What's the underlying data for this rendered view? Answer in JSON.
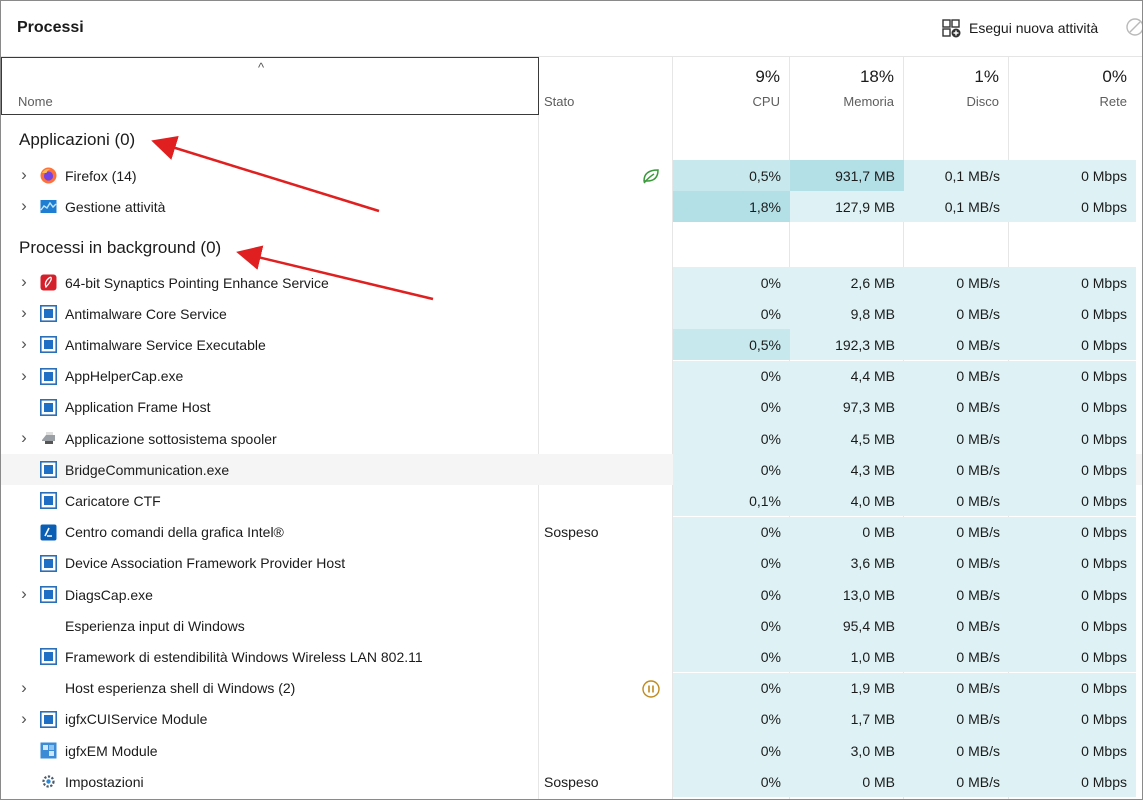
{
  "header": {
    "title": "Processi",
    "run_new_task_label": "Esegui nuova attività"
  },
  "columns": {
    "name": "Nome",
    "status": "Stato",
    "cpu": {
      "pct": "9%",
      "label": "CPU"
    },
    "memory": {
      "pct": "18%",
      "label": "Memoria"
    },
    "disk": {
      "pct": "1%",
      "label": "Disco"
    },
    "network": {
      "pct": "0%",
      "label": "Rete"
    }
  },
  "groups": {
    "apps": "Applicazioni (0)",
    "background": "Processi in background (0)"
  },
  "apps": [
    {
      "name": "Firefox (14)",
      "status": "",
      "cpu": "0,5%",
      "mem": "931,7 MB",
      "disk": "0,1 MB/s",
      "net": "0 Mbps",
      "icon": "firefox-icon",
      "expandable": true
    },
    {
      "name": "Gestione attività",
      "status": "",
      "cpu": "1,8%",
      "mem": "127,9 MB",
      "disk": "0,1 MB/s",
      "net": "0 Mbps",
      "icon": "task-manager-icon",
      "expandable": true
    }
  ],
  "background": [
    {
      "name": "64-bit Synaptics Pointing Enhance Service",
      "status": "",
      "cpu": "0%",
      "mem": "2,6 MB",
      "disk": "0 MB/s",
      "net": "0 Mbps",
      "icon": "synaptics-icon",
      "expandable": true
    },
    {
      "name": "Antimalware Core Service",
      "status": "",
      "cpu": "0%",
      "mem": "9,8 MB",
      "disk": "0 MB/s",
      "net": "0 Mbps",
      "icon": "window-icon",
      "expandable": true
    },
    {
      "name": "Antimalware Service Executable",
      "status": "",
      "cpu": "0,5%",
      "mem": "192,3 MB",
      "disk": "0 MB/s",
      "net": "0 Mbps",
      "icon": "window-icon",
      "expandable": true
    },
    {
      "name": "AppHelperCap.exe",
      "status": "",
      "cpu": "0%",
      "mem": "4,4 MB",
      "disk": "0 MB/s",
      "net": "0 Mbps",
      "icon": "window-icon",
      "expandable": true
    },
    {
      "name": "Application Frame Host",
      "status": "",
      "cpu": "0%",
      "mem": "97,3 MB",
      "disk": "0 MB/s",
      "net": "0 Mbps",
      "icon": "window-icon",
      "expandable": false
    },
    {
      "name": "Applicazione sottosistema spooler",
      "status": "",
      "cpu": "0%",
      "mem": "4,5 MB",
      "disk": "0 MB/s",
      "net": "0 Mbps",
      "icon": "printer-icon",
      "expandable": true
    },
    {
      "name": "BridgeCommunication.exe",
      "status": "",
      "cpu": "0%",
      "mem": "4,3 MB",
      "disk": "0 MB/s",
      "net": "0 Mbps",
      "icon": "window-icon",
      "expandable": false
    },
    {
      "name": "Caricatore CTF",
      "status": "",
      "cpu": "0,1%",
      "mem": "4,0 MB",
      "disk": "0 MB/s",
      "net": "0 Mbps",
      "icon": "window-icon",
      "expandable": false
    },
    {
      "name": "Centro comandi della grafica Intel®",
      "status": "Sospeso",
      "cpu": "0%",
      "mem": "0 MB",
      "disk": "0 MB/s",
      "net": "0 Mbps",
      "icon": "intel-graphics-icon",
      "expandable": false
    },
    {
      "name": "Device Association Framework Provider Host",
      "status": "",
      "cpu": "0%",
      "mem": "3,6 MB",
      "disk": "0 MB/s",
      "net": "0 Mbps",
      "icon": "window-icon",
      "expandable": false
    },
    {
      "name": "DiagsCap.exe",
      "status": "",
      "cpu": "0%",
      "mem": "13,0 MB",
      "disk": "0 MB/s",
      "net": "0 Mbps",
      "icon": "window-icon",
      "expandable": true
    },
    {
      "name": "Esperienza input di Windows",
      "status": "",
      "cpu": "0%",
      "mem": "95,4 MB",
      "disk": "0 MB/s",
      "net": "0 Mbps",
      "icon": "",
      "expandable": false
    },
    {
      "name": "Framework di estendibilità Windows Wireless LAN 802.11",
      "status": "",
      "cpu": "0%",
      "mem": "1,0 MB",
      "disk": "0 MB/s",
      "net": "0 Mbps",
      "icon": "window-icon",
      "expandable": false
    },
    {
      "name": "Host esperienza shell di Windows (2)",
      "status": "",
      "cpu": "0%",
      "mem": "1,9 MB",
      "disk": "0 MB/s",
      "net": "0 Mbps",
      "icon": "",
      "expandable": true
    },
    {
      "name": "igfxCUIService Module",
      "status": "",
      "cpu": "0%",
      "mem": "1,7 MB",
      "disk": "0 MB/s",
      "net": "0 Mbps",
      "icon": "window-icon",
      "expandable": true
    },
    {
      "name": "igfxEM Module",
      "status": "",
      "cpu": "0%",
      "mem": "3,0 MB",
      "disk": "0 MB/s",
      "net": "0 Mbps",
      "icon": "igfx-icon",
      "expandable": false
    },
    {
      "name": "Impostazioni",
      "status": "Sospeso",
      "cpu": "0%",
      "mem": "0 MB",
      "disk": "0 MB/s",
      "net": "0 Mbps",
      "icon": "gear-icon",
      "expandable": false
    }
  ],
  "colors": {
    "heat_low": "#def2f5",
    "heat_mid": "#c7e9ee",
    "heat_high": "#b3e0e7",
    "annotation_arrow": "#e02020",
    "eco_leaf": "#3a9a3a",
    "pause_badge": "#c08a1e"
  }
}
